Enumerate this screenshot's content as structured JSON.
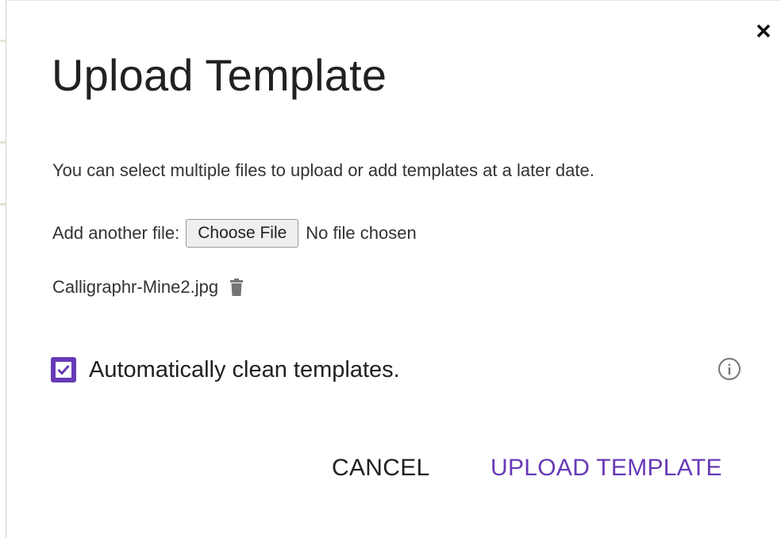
{
  "dialog": {
    "title": "Upload Template",
    "description": "You can select multiple files to upload or add templates at a later date.",
    "file_input": {
      "label": "Add another file:",
      "button_label": "Choose File",
      "status": "No file chosen"
    },
    "selected_files": [
      {
        "name": "Calligraphr-Mine2.jpg"
      }
    ],
    "auto_clean": {
      "label": "Automatically clean templates.",
      "checked": true
    },
    "actions": {
      "cancel_label": "CANCEL",
      "upload_label": "UPLOAD TEMPLATE"
    },
    "icons": {
      "close": "close-icon",
      "delete": "trash-icon",
      "checkbox": "check-icon",
      "info": "info-icon"
    },
    "colors": {
      "accent": "#673ab7",
      "text": "#212121",
      "muted_icon": "#757575"
    }
  }
}
